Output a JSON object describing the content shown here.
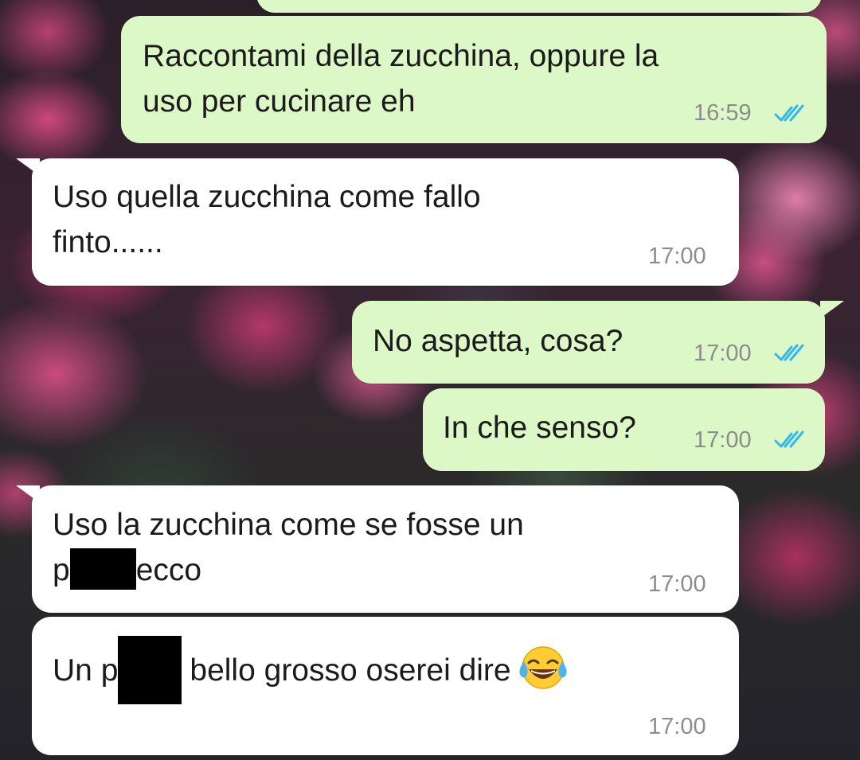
{
  "conversation": {
    "messages": [
      {
        "direction": "outgoing",
        "lines": [
          "Raccontami della zucchina, oppure la",
          "uso per cucinare eh"
        ],
        "time": "16:59",
        "status": "read"
      },
      {
        "direction": "incoming",
        "lines": [
          "Uso quella zucchina come fallo",
          "finto......"
        ],
        "time": "17:00"
      },
      {
        "direction": "outgoing",
        "lines": [
          "No aspetta, cosa?"
        ],
        "time": "17:00",
        "status": "read"
      },
      {
        "direction": "outgoing",
        "lines": [
          "In che senso?"
        ],
        "time": "17:00",
        "status": "read"
      },
      {
        "direction": "incoming",
        "line1": "Uso la zucchina come se fosse un",
        "line2_before": "p",
        "line2_after": "ecco",
        "time": "17:00"
      },
      {
        "direction": "incoming",
        "before": "Un p",
        "after": "bello grosso oserei dire",
        "emoji": "face-with-tears-of-joy-icon",
        "time": "17:00"
      }
    ]
  },
  "colors": {
    "outgoing_bubble": "#dcf8c6",
    "incoming_bubble": "#ffffff",
    "read_ticks": "#34b7f1",
    "timestamp": "#8c8c8c"
  }
}
